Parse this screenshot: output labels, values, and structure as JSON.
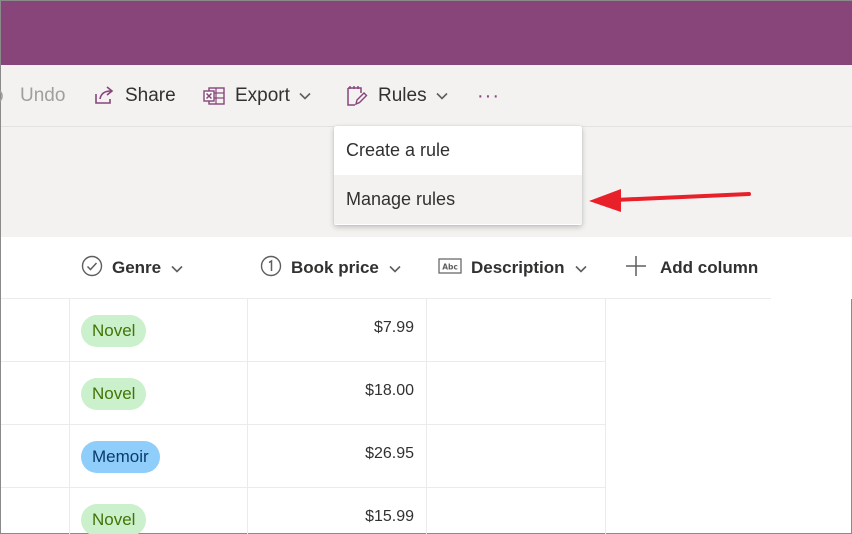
{
  "toolbar": {
    "undo_label": "Undo",
    "share_label": "Share",
    "export_label": "Export",
    "rules_label": "Rules",
    "more_label": "···"
  },
  "rules_menu": {
    "items": [
      {
        "label": "Create a rule",
        "highlighted": false
      },
      {
        "label": "Manage rules",
        "highlighted": true
      }
    ]
  },
  "columns": {
    "genre": "Genre",
    "book_price": "Book price",
    "description": "Description",
    "add_column": "Add column"
  },
  "rows": [
    {
      "genre": "Novel",
      "genre_color": "#caf0cc",
      "price": "$7.99",
      "description": ""
    },
    {
      "genre": "Novel",
      "genre_color": "#caf0cc",
      "price": "$18.00",
      "description": ""
    },
    {
      "genre": "Memoir",
      "genre_color": "#8fcdfb",
      "price": "$26.95",
      "description": ""
    },
    {
      "genre": "Novel",
      "genre_color": "#caf0cc",
      "price": "$15.99",
      "description": ""
    }
  ],
  "colors": {
    "suite_bar": "#87457a",
    "toolbar_bg": "#f3f2f1",
    "annotation_arrow": "#e8202a"
  },
  "icons": {
    "undo": "undo-icon",
    "share": "share-icon",
    "export": "excel-icon",
    "rules": "rules-icon",
    "genre": "choice-check-icon",
    "book_price": "number-icon",
    "description": "text-abc-icon",
    "add_column": "plus-icon"
  }
}
